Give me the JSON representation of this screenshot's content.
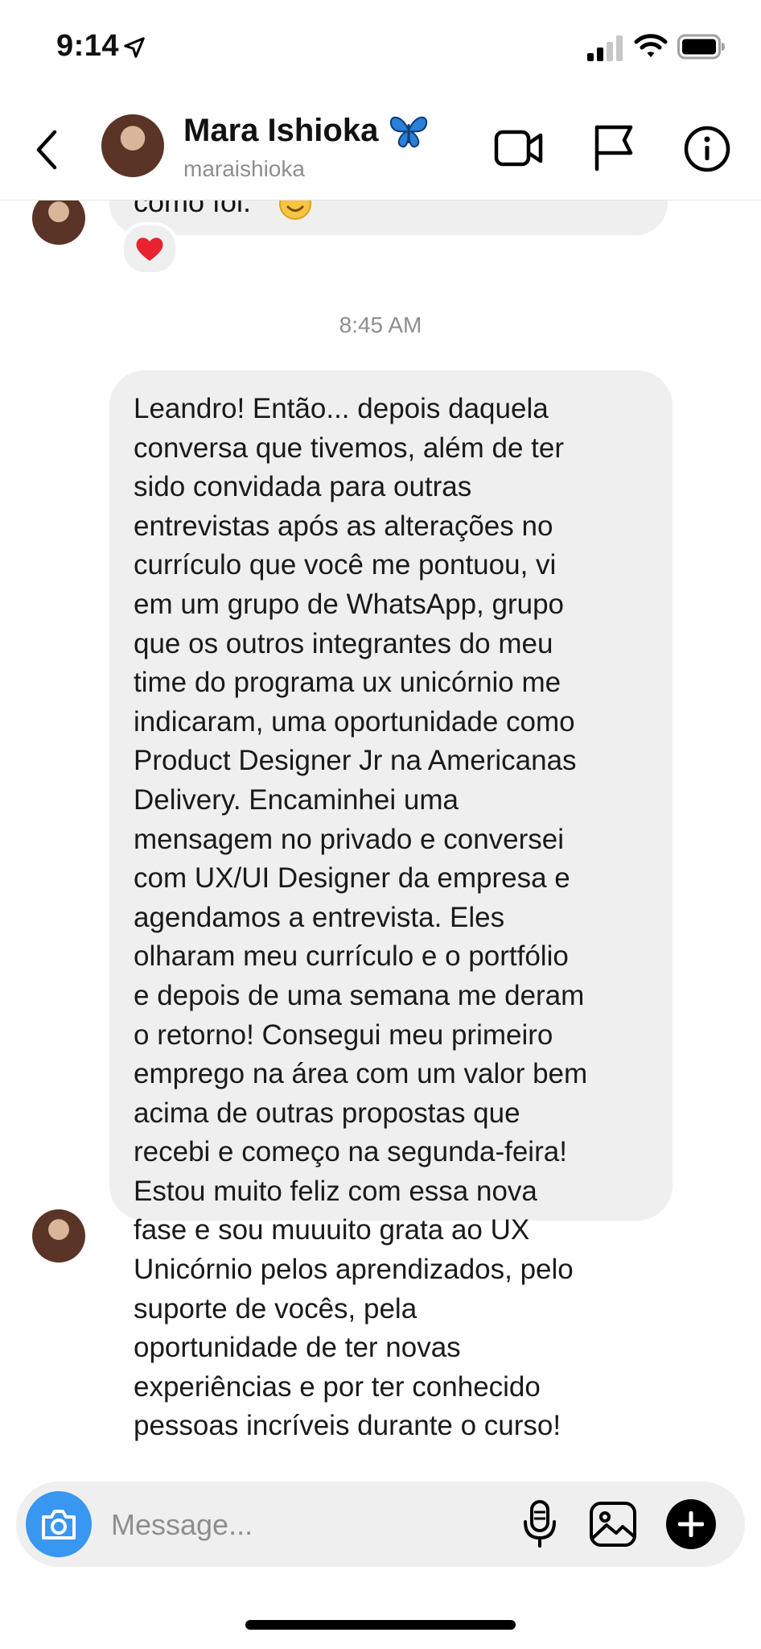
{
  "status_bar": {
    "time": "9:14",
    "icons": [
      "location-arrow-icon",
      "cellular-signal-icon",
      "wifi-icon",
      "battery-icon"
    ]
  },
  "header": {
    "contact_name": "Mara Ishioka",
    "contact_username": "maraishioka",
    "name_emoji": "butterfly",
    "actions": [
      "back",
      "video-call",
      "flag",
      "info"
    ]
  },
  "chat": {
    "previous_message": {
      "visible_text": "como foi.",
      "emoji": "smiling-face",
      "reaction": "heart"
    },
    "timestamp": "8:45 AM",
    "message": {
      "lines": [
        "Leandro! Então... depois daquela",
        "conversa que tivemos, além de ter",
        "sido convidada para outras",
        "entrevistas após as alterações no",
        "currículo que você me pontuou, vi",
        "em um grupo de WhatsApp, grupo",
        "que os outros integrantes do meu",
        "time do programa ux unicórnio me",
        "indicaram, uma oportunidade como",
        "Product Designer Jr na Americanas",
        "Delivery. Encaminhei uma",
        "mensagem no privado e conversei",
        "com UX/UI Designer da empresa e",
        "agendamos a entrevista. Eles",
        "olharam meu currículo e o portfólio",
        "e depois de uma semana me deram",
        "o retorno! Consegui meu primeiro",
        "emprego na área com um valor bem",
        "acima de outras propostas que",
        "recebi e começo na segunda-feira!",
        "Estou muito feliz com essa nova",
        "fase e sou muuuito grata ao UX",
        "Unicórnio pelos aprendizados, pelo",
        "suporte de vocês, pela",
        "oportunidade de ter novas",
        "experiências e por ter conhecido",
        "pessoas incríveis durante o curso!"
      ]
    }
  },
  "composer": {
    "placeholder": "Message...",
    "value": "",
    "accent_color": "#3897f0"
  }
}
